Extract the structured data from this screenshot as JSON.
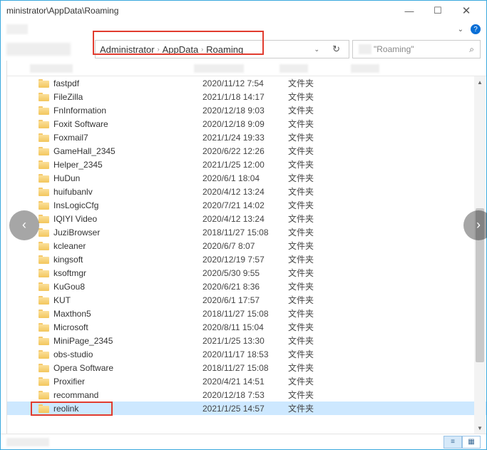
{
  "title": "ministrator\\AppData\\Roaming",
  "breadcrumb": {
    "a": "Administrator",
    "b": "AppData",
    "c": "Roaming"
  },
  "search_placeholder": "\"Roaming\"",
  "type_label": "文件夹",
  "windowbtn": {
    "min": "—",
    "max": "☐",
    "close": "✕"
  },
  "crumbsep": "›",
  "addr_drop": "⌄",
  "addr_refresh": "↻",
  "menubar_chev": "⌄",
  "help": "?",
  "search_icon": "⌕",
  "left_hint": "‹",
  "right_hint": "›",
  "scroll_up": "▲",
  "scroll_down": "▼",
  "vt_details": "≡",
  "vt_icons": "▦",
  "files": [
    {
      "name": "fastpdf",
      "date": "2020/11/12 7:54"
    },
    {
      "name": "FileZilla",
      "date": "2021/1/18 14:17"
    },
    {
      "name": "FnInformation",
      "date": "2020/12/18 9:03"
    },
    {
      "name": "Foxit Software",
      "date": "2020/12/18 9:09"
    },
    {
      "name": "Foxmail7",
      "date": "2021/1/24 19:33"
    },
    {
      "name": "GameHall_2345",
      "date": "2020/6/22 12:26"
    },
    {
      "name": "Helper_2345",
      "date": "2021/1/25 12:00"
    },
    {
      "name": "HuDun",
      "date": "2020/6/1 18:04"
    },
    {
      "name": "huifubanlv",
      "date": "2020/4/12 13:24"
    },
    {
      "name": "InsLogicCfg",
      "date": "2020/7/21 14:02"
    },
    {
      "name": "IQIYI Video",
      "date": "2020/4/12 13:24"
    },
    {
      "name": "JuziBrowser",
      "date": "2018/11/27 15:08"
    },
    {
      "name": "kcleaner",
      "date": "2020/6/7 8:07"
    },
    {
      "name": "kingsoft",
      "date": "2020/12/19 7:57"
    },
    {
      "name": "ksoftmgr",
      "date": "2020/5/30 9:55"
    },
    {
      "name": "KuGou8",
      "date": "2020/6/21 8:36"
    },
    {
      "name": "KUT",
      "date": "2020/6/1 17:57"
    },
    {
      "name": "Maxthon5",
      "date": "2018/11/27 15:08"
    },
    {
      "name": "Microsoft",
      "date": "2020/8/11 15:04"
    },
    {
      "name": "MiniPage_2345",
      "date": "2021/1/25 13:30"
    },
    {
      "name": "obs-studio",
      "date": "2020/11/17 18:53"
    },
    {
      "name": "Opera Software",
      "date": "2018/11/27 15:08"
    },
    {
      "name": "Proxifier",
      "date": "2020/4/21 14:51"
    },
    {
      "name": "recommand",
      "date": "2020/12/18 7:53"
    },
    {
      "name": "reolink",
      "date": "2021/1/25 14:57"
    }
  ]
}
